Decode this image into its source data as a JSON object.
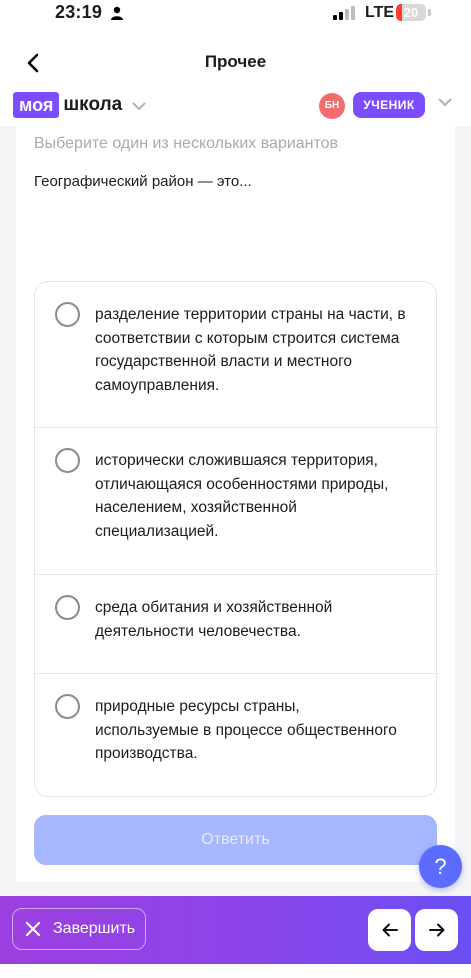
{
  "status_bar": {
    "time": "23:19",
    "network": "LTE",
    "battery_level": "20",
    "battery_fraction": 0.2,
    "icons": [
      "person-icon",
      "signal-icon",
      "battery-icon"
    ]
  },
  "header": {
    "title": "Прочее",
    "back_icon": "chevron-left-icon"
  },
  "app_bar": {
    "logo_part1": "моя",
    "logo_part2": "школа",
    "avatar_initials": "БН",
    "role": "УЧЕНИК"
  },
  "question": {
    "instruction": "Выберите один из нескольких вариантов",
    "text": "Географический район — это...",
    "options": [
      {
        "lines": [
          "разделение территории страны на части, в",
          "соответствии с которым строится система",
          "государственной власти и местного",
          "самоуправления."
        ]
      },
      {
        "lines": [
          "исторически сложившаяся территория,",
          "отличающаяся особенностями природы,",
          "населением, хозяйственной",
          "специализацией."
        ]
      },
      {
        "lines": [
          "среда обитания и хозяйственной",
          "деятельности человечества."
        ]
      },
      {
        "lines": [
          "природные ресурсы страны,",
          "используемые в процессе общественного",
          "производства."
        ]
      }
    ],
    "submit_label": "Ответить"
  },
  "help": {
    "label": "?"
  },
  "bottom_bar": {
    "finish_label": "Завершить",
    "prev_icon": "arrow-left-icon",
    "next_icon": "arrow-right-icon"
  },
  "colors": {
    "accent": "#7b4dff",
    "avatar": "#f26d6d",
    "submit_disabled": "#a6b6ff",
    "help": "#5b6cff",
    "bar_gradient_start": "#9d3fe0",
    "bar_gradient_end": "#6a4ff5"
  }
}
